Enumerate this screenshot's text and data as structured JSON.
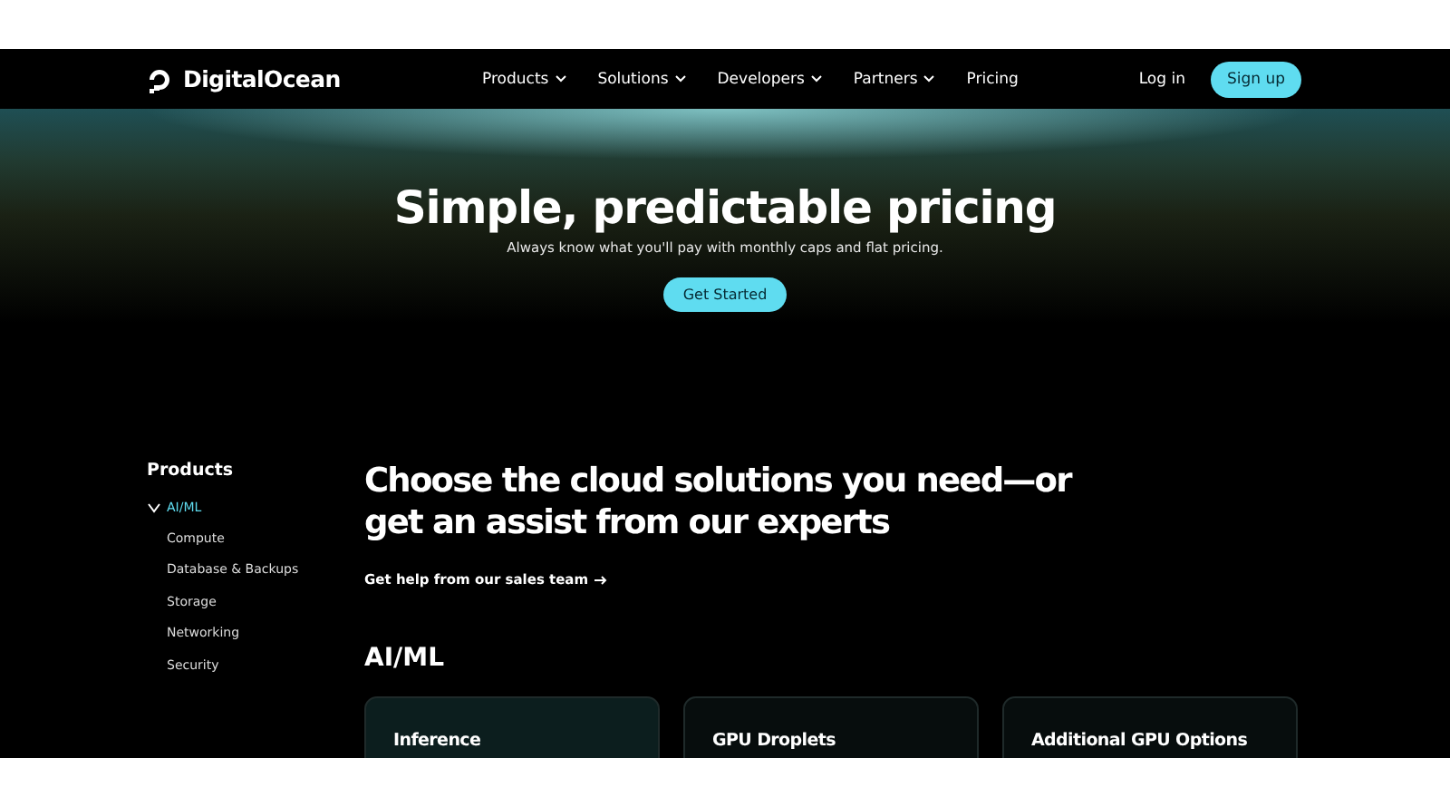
{
  "nav": {
    "brand": "DigitalOcean",
    "menu": [
      {
        "label": "Products",
        "dropdown": true
      },
      {
        "label": "Solutions",
        "dropdown": true
      },
      {
        "label": "Developers",
        "dropdown": true
      },
      {
        "label": "Partners",
        "dropdown": true
      },
      {
        "label": "Pricing",
        "dropdown": false
      }
    ],
    "login": "Log in",
    "signup": "Sign up"
  },
  "hero": {
    "title": "Simple, predictable pricing",
    "subtitle": "Always know what you'll pay with monthly caps and flat pricing.",
    "cta": "Get Started"
  },
  "sidebar": {
    "heading": "Products",
    "items": [
      {
        "label": "AI/ML",
        "selected": true
      },
      {
        "label": "Compute",
        "selected": false
      },
      {
        "label": "Database & Backups",
        "selected": false
      },
      {
        "label": "Storage",
        "selected": false
      },
      {
        "label": "Networking",
        "selected": false
      },
      {
        "label": "Security",
        "selected": false
      }
    ]
  },
  "main": {
    "headline": "Choose the cloud solutions you need—or get an assist from our experts",
    "link": "Get help from our sales team",
    "section": "AI/ML",
    "cards": [
      {
        "title": "Inference",
        "highlighted": true
      },
      {
        "title": "GPU Droplets",
        "highlighted": false
      },
      {
        "title": "Additional GPU Options",
        "highlighted": false
      }
    ]
  }
}
